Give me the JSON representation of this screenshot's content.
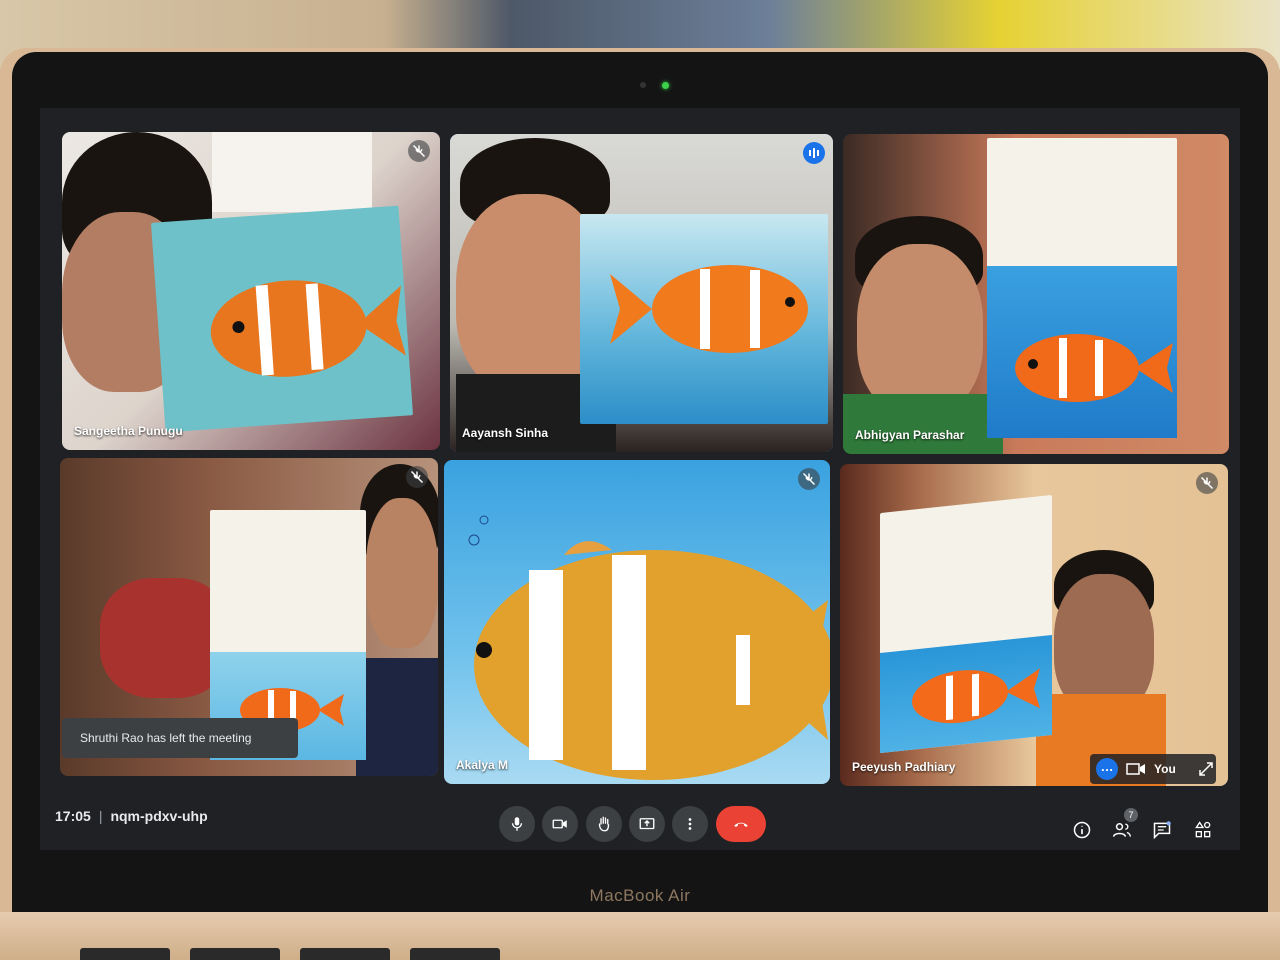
{
  "device": {
    "brand": "MacBook Air"
  },
  "meeting": {
    "time": "17:05",
    "separator": "|",
    "code": "nqm-pdxv-uhp"
  },
  "participants": [
    {
      "name": "Sangeetha Punugu",
      "muted": true
    },
    {
      "name": "Aayansh Sinha",
      "speaking": true
    },
    {
      "name": "Abhigyan Parashar"
    },
    {
      "name": "",
      "muted": true
    },
    {
      "name": "Akalya M",
      "muted": true
    },
    {
      "name": "Peeyush Padhiary",
      "muted": true
    }
  ],
  "toast": {
    "text": "Shruthi Rao has left the meeting"
  },
  "self_view": {
    "label": "You"
  },
  "controls": [
    "microphone-icon",
    "camera-icon",
    "raise-hand-icon",
    "present-icon",
    "more-options-icon",
    "end-call-icon"
  ],
  "right_controls": {
    "participants_count": "7"
  },
  "colors": {
    "speaking_outline": "#4f8ef7",
    "end_call": "#ea4335",
    "control_bg": "#3c4043",
    "accent": "#1a73e8"
  }
}
